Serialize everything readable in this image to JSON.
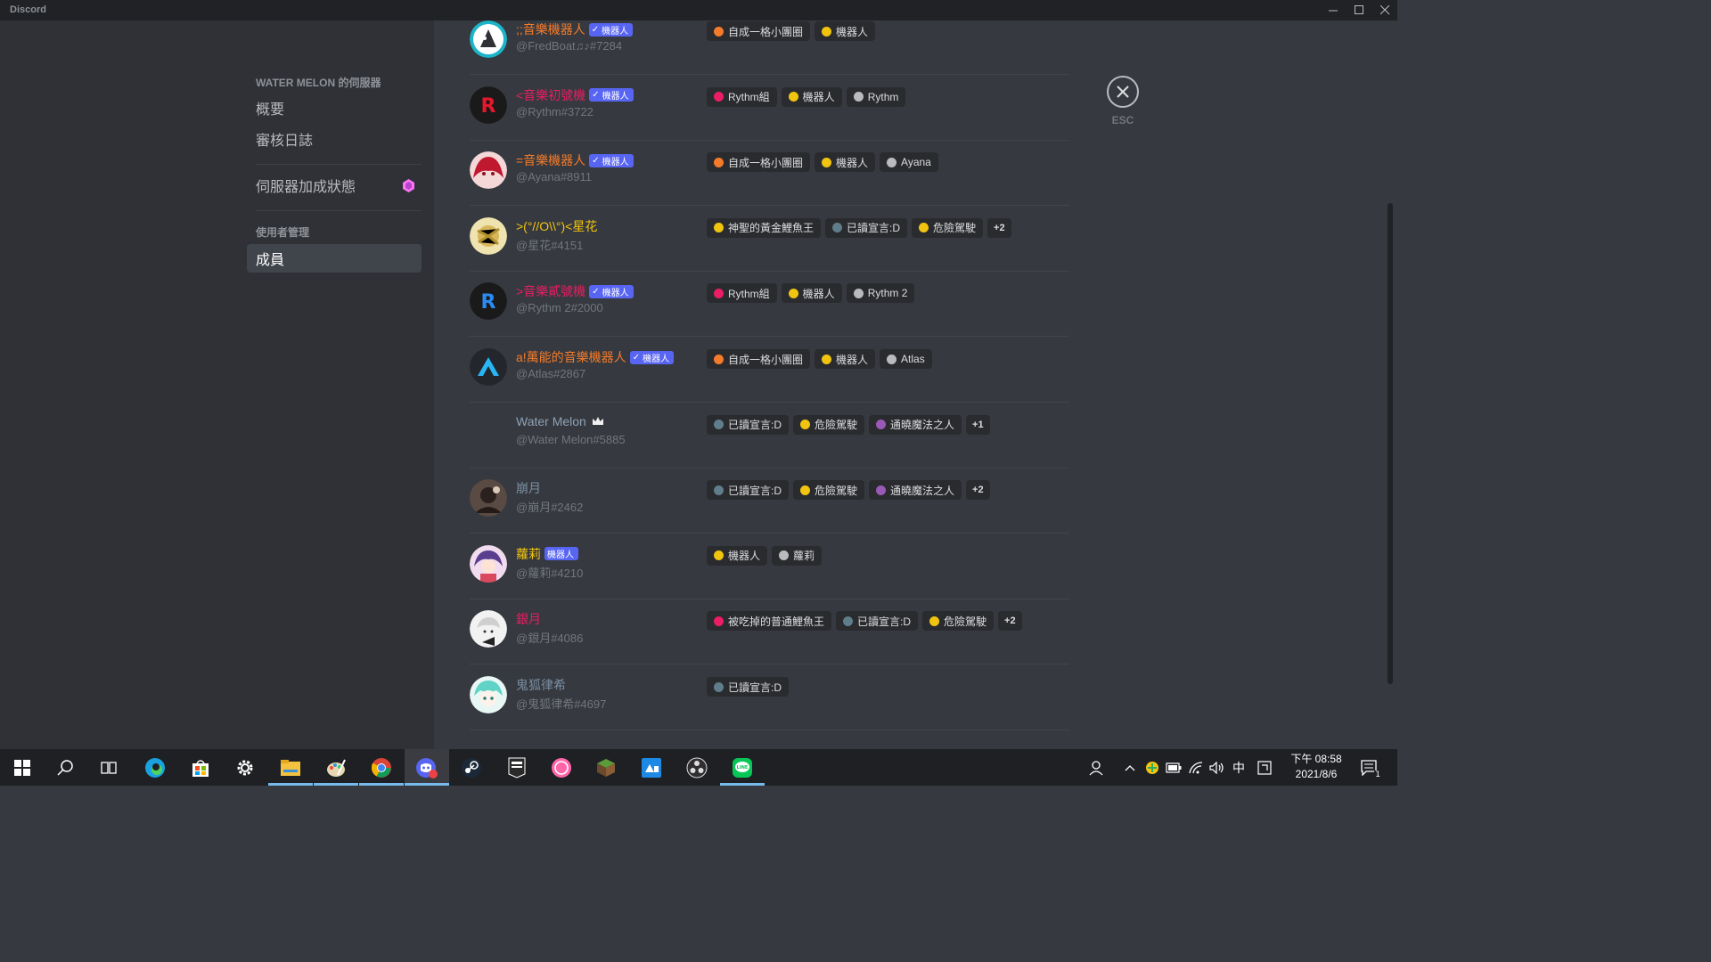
{
  "window": {
    "app_title": "Discord"
  },
  "sidebar": {
    "server_header": "WATER MELON 的伺服器",
    "items": [
      {
        "label": "概要"
      },
      {
        "label": "審核日誌"
      },
      {
        "label": "伺服器加成狀態"
      }
    ],
    "user_mgmt_header": "使用者管理",
    "selected_item": "成員"
  },
  "close": {
    "esc_label": "ESC"
  },
  "bot_tag_label": "機器人",
  "members": [
    {
      "name": ";;音樂機器人",
      "username": "@FredBoat♫♪#7284",
      "name_color": "#f47b2a",
      "bot": true,
      "verified": true,
      "roles": [
        {
          "name": "自成一格小團圈",
          "color": "#f47b2a"
        },
        {
          "name": "機器人",
          "color": "#f1c40f"
        }
      ],
      "more": ""
    },
    {
      "name": "<音樂初號機",
      "username": "@Rythm#3722",
      "name_color": "#e91e63",
      "bot": true,
      "verified": true,
      "roles": [
        {
          "name": "Rythm組",
          "color": "#e91e63"
        },
        {
          "name": "機器人",
          "color": "#f1c40f"
        },
        {
          "name": "Rythm",
          "color": "#b9bbbe"
        }
      ],
      "more": ""
    },
    {
      "name": "=音樂機器人",
      "username": "@Ayana#8911",
      "name_color": "#f47b2a",
      "bot": true,
      "verified": true,
      "roles": [
        {
          "name": "自成一格小團圈",
          "color": "#f47b2a"
        },
        {
          "name": "機器人",
          "color": "#f1c40f"
        },
        {
          "name": "Ayana",
          "color": "#b9bbbe"
        }
      ],
      "more": ""
    },
    {
      "name": ">(°//O\\\\°)<星花",
      "username": "@星花#4151",
      "name_color": "#f1c40f",
      "bot": false,
      "verified": false,
      "roles": [
        {
          "name": "神聖的黃金鯉魚王",
          "color": "#f1c40f"
        },
        {
          "name": "已讀宣言:D",
          "color": "#607d8b"
        },
        {
          "name": "危險駕駛",
          "color": "#f1c40f"
        }
      ],
      "more": "+2"
    },
    {
      "name": ">音樂貳號機",
      "username": "@Rythm 2#2000",
      "name_color": "#e91e63",
      "bot": true,
      "verified": true,
      "roles": [
        {
          "name": "Rythm組",
          "color": "#e91e63"
        },
        {
          "name": "機器人",
          "color": "#f1c40f"
        },
        {
          "name": "Rythm 2",
          "color": "#b9bbbe"
        }
      ],
      "more": ""
    },
    {
      "name": "a!萬能的音樂機器人",
      "username": "@Atlas#2867",
      "name_color": "#f47b2a",
      "bot": true,
      "verified": true,
      "roles": [
        {
          "name": "自成一格小團圈",
          "color": "#f47b2a"
        },
        {
          "name": "機器人",
          "color": "#f1c40f"
        },
        {
          "name": "Atlas",
          "color": "#b9bbbe"
        }
      ],
      "more": ""
    },
    {
      "name": "Water Melon",
      "username": "@Water Melon#5885",
      "name_color": "#8ea1b5",
      "bot": false,
      "verified": false,
      "owner": true,
      "roles": [
        {
          "name": "已讀宣言:D",
          "color": "#607d8b"
        },
        {
          "name": "危險駕駛",
          "color": "#f1c40f"
        },
        {
          "name": "通曉魔法之人",
          "color": "#9b59b6"
        }
      ],
      "more": "+1"
    },
    {
      "name": "崩月",
      "username": "@崩月#2462",
      "name_color": "#7b8ea3",
      "bot": false,
      "verified": false,
      "roles": [
        {
          "name": "已讀宣言:D",
          "color": "#607d8b"
        },
        {
          "name": "危險駕駛",
          "color": "#f1c40f"
        },
        {
          "name": "通曉魔法之人",
          "color": "#9b59b6"
        }
      ],
      "more": "+2"
    },
    {
      "name": "蘿莉",
      "username": "@蘿莉#4210",
      "name_color": "#f1c40f",
      "bot": true,
      "verified": false,
      "roles": [
        {
          "name": "機器人",
          "color": "#f1c40f"
        },
        {
          "name": "蘿莉",
          "color": "#b9bbbe"
        }
      ],
      "more": ""
    },
    {
      "name": "銀月",
      "username": "@銀月#4086",
      "name_color": "#e91e63",
      "bot": false,
      "verified": false,
      "roles": [
        {
          "name": "被吃掉的普通鯉魚王",
          "color": "#e91e63"
        },
        {
          "name": "已讀宣言:D",
          "color": "#607d8b"
        },
        {
          "name": "危險駕駛",
          "color": "#f1c40f"
        }
      ],
      "more": "+2"
    },
    {
      "name": "鬼狐律希",
      "username": "@鬼狐律希#4697",
      "name_color": "#7b8ea3",
      "bot": false,
      "verified": false,
      "roles": [
        {
          "name": "已讀宣言:D",
          "color": "#607d8b"
        }
      ],
      "more": ""
    }
  ],
  "taskbar": {
    "clock_time": "下午 08:58",
    "clock_date": "2021/8/6",
    "ime_label": "中",
    "notification_count": "1",
    "apps": [
      "windows-start-icon",
      "search-icon",
      "task-view-icon",
      "edge-icon",
      "store-icon",
      "settings-icon",
      "file-explorer-icon",
      "paint-icon",
      "chrome-icon",
      "discord-icon",
      "steam-icon",
      "epic-games-icon",
      "osu-icon",
      "minecraft-icon",
      "capture-icon",
      "obs-icon",
      "line-icon"
    ]
  }
}
